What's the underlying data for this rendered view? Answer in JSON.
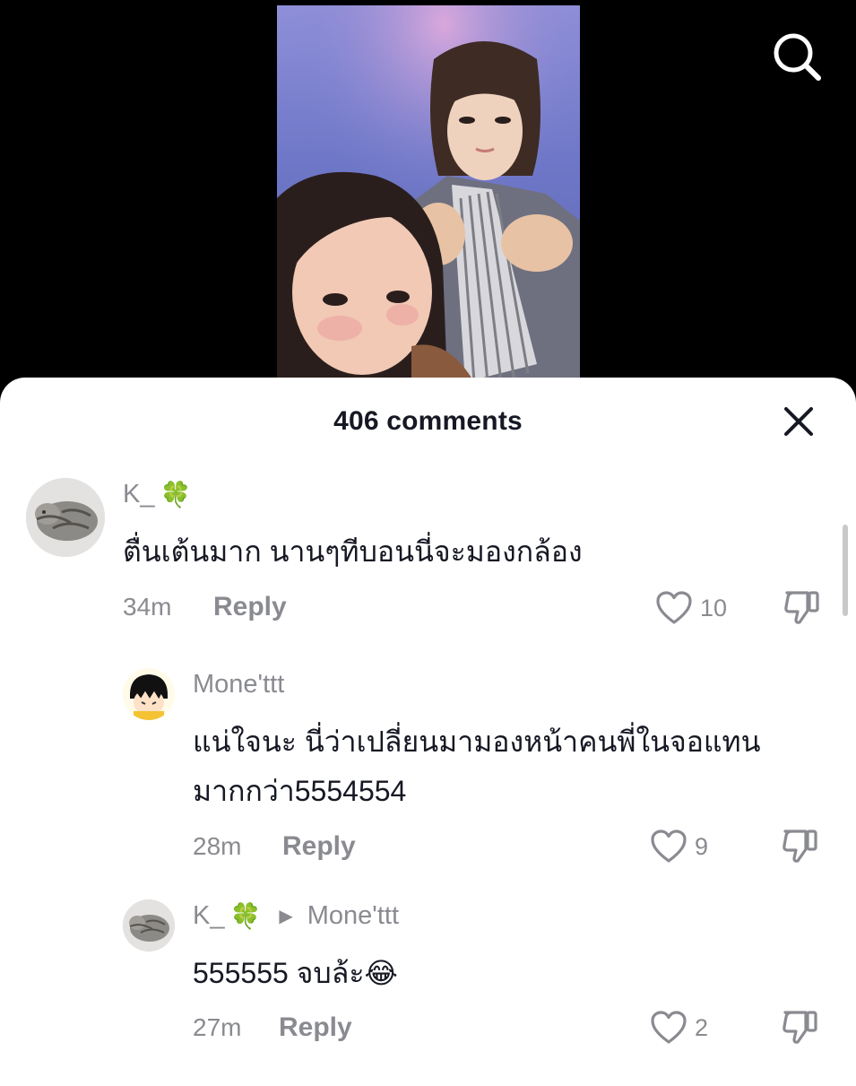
{
  "header": {
    "comment_count_label": "406 comments"
  },
  "icons": {
    "search": "search-icon",
    "close": "close-icon",
    "like": "heart-icon",
    "dislike": "thumbs-down-icon"
  },
  "comments": [
    {
      "username": "K_",
      "username_emoji": "🍀",
      "text_lines": [
        "ตื่นเต้นมาก นานๆทีบอนนี่จะมองกล้อง"
      ],
      "time": "34m",
      "reply_label": "Reply",
      "likes": "10"
    },
    {
      "username": "Mone'ttt",
      "text_lines": [
        "แน่ใจนะ นี่ว่าเปลี่ยนมามองหน้าคนพี่ในจอแทน",
        "มากกว่า5554554"
      ],
      "time": "28m",
      "reply_label": "Reply",
      "likes": "9"
    },
    {
      "username": "K_",
      "username_emoji": "🍀",
      "reply_to": "Mone'ttt",
      "text_lines": [
        "555555 จบล้ะ😂"
      ],
      "time": "27m",
      "reply_label": "Reply",
      "likes": "2"
    }
  ],
  "colors": {
    "sheet_bg": "#ffffff",
    "text_primary": "#161823",
    "text_secondary": "#8a8b91",
    "clover_green": "#2e9a2e"
  }
}
